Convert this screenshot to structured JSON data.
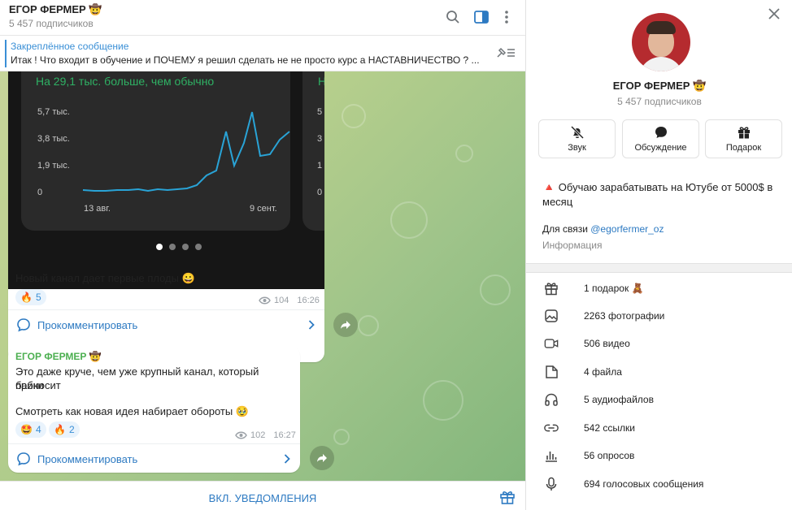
{
  "chat": {
    "title": "ЕГОР ФЕРМЕР 🤠",
    "subscribers": "5 457 подписчиков",
    "pinned": {
      "title": "Закреплённое сообщение",
      "text": "Итак ! Что входит в обучение и ПОЧЕМУ я решил сделать не не просто курс а НАСТАВНИЧЕСТВО ?  ..."
    },
    "notify_label": "ВКЛ. УВЕДОМЛЕНИЯ"
  },
  "messages": [
    {
      "screenshot": {
        "headline": "На 29,1 тыс. больше, чем обычно",
        "headline_partial": "Н",
        "y_ticks": [
          "5,7 тыс.",
          "3,8 тыс.",
          "1,9 тыс.",
          "0"
        ],
        "y_ticks_partial": [
          "5",
          "3",
          "1",
          "0"
        ],
        "x_ticks": [
          "13 авг.",
          "9 сент."
        ],
        "slides": 4,
        "active_slide": 0,
        "line_color": "#29a3d6"
      },
      "text": "Новый канал дает первые плоды 😀",
      "reactions": [
        {
          "emoji": "🔥",
          "count": "5"
        }
      ],
      "views": "104",
      "time": "16:26",
      "comment_label": "Прокомментировать"
    },
    {
      "sender": "ЕГОР ФЕРМЕР 🤠",
      "text_line1": "Это даже круче, чем уже крупный канал, который приносит",
      "text_line2": "бабки",
      "text_line3": "Смотреть как новая идея набирает обороты 🥹",
      "reactions": [
        {
          "emoji": "🤩",
          "count": "4"
        },
        {
          "emoji": "🔥",
          "count": "2"
        }
      ],
      "views": "102",
      "time": "16:27",
      "comment_label": "Прокомментировать"
    }
  ],
  "info": {
    "name": "ЕГОР ФЕРМЕР 🤠",
    "subscribers": "5 457 подписчиков",
    "actions": [
      {
        "label": "Звук",
        "icon": "bell-off-icon"
      },
      {
        "label": "Обсуждение",
        "icon": "chat-bubble-icon"
      },
      {
        "label": "Подарок",
        "icon": "gift-icon"
      }
    ],
    "about_line1": "🔺 Обучаю зарабатывать на Ютубе от 5000$ в",
    "about_line2": "месяц",
    "contact_prefix": "Для связи ",
    "contact_link": "@egorfermer_oz",
    "info_label": "Информация",
    "media": [
      {
        "label": "1 подарок 🧸",
        "icon": "gift-icon"
      },
      {
        "label": "2263 фотографии",
        "icon": "photo-icon"
      },
      {
        "label": "506 видео",
        "icon": "video-icon"
      },
      {
        "label": "4 файла",
        "icon": "file-icon"
      },
      {
        "label": "5 аудиофайлов",
        "icon": "headphones-icon"
      },
      {
        "label": "542 ссылки",
        "icon": "link-icon"
      },
      {
        "label": "56 опросов",
        "icon": "poll-icon"
      },
      {
        "label": "694 голосовых сообщения",
        "icon": "microphone-icon"
      }
    ]
  },
  "colors": {
    "accent": "#2d7ac2",
    "sender": "#4caf50",
    "chart_positive": "#2fb164"
  }
}
